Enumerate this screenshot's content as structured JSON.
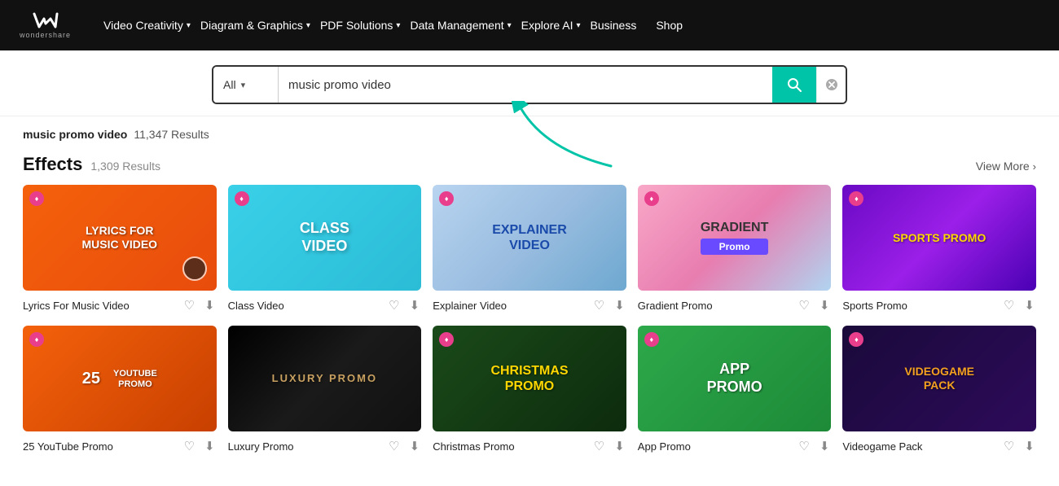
{
  "brand": {
    "name": "wondershare",
    "logo_symbol": "W"
  },
  "navbar": {
    "items": [
      {
        "label": "Video Creativity",
        "hasDropdown": true
      },
      {
        "label": "Diagram & Graphics",
        "hasDropdown": true
      },
      {
        "label": "PDF Solutions",
        "hasDropdown": true
      },
      {
        "label": "Data Management",
        "hasDropdown": true
      },
      {
        "label": "Explore AI",
        "hasDropdown": true
      },
      {
        "label": "Business",
        "hasDropdown": false
      },
      {
        "label": "Shop",
        "hasDropdown": false
      }
    ]
  },
  "search": {
    "dropdown_label": "All",
    "placeholder": "music promo video",
    "value": "music promo video",
    "search_button_label": "Search",
    "clear_button_label": "Clear"
  },
  "results": {
    "query": "music promo video",
    "count": "11,347 Results"
  },
  "effects_section": {
    "title": "Effects",
    "count": "1,309 Results",
    "view_more": "View More"
  },
  "cards_row1": [
    {
      "id": "lyrics-music-video",
      "title": "Lyrics For Music Video",
      "thumb_type": "lyrics",
      "thumb_label": "LYRICS FOR\nMUSIC VIDEO"
    },
    {
      "id": "class-video",
      "title": "Class Video",
      "thumb_type": "class",
      "thumb_label": "CLASS\nVIDEO"
    },
    {
      "id": "explainer-video",
      "title": "Explainer Video",
      "thumb_type": "explainer",
      "thumb_label": "EXPLAINER\nVIDEO"
    },
    {
      "id": "gradient-promo",
      "title": "Gradient Promo",
      "thumb_type": "gradient",
      "thumb_label": "GRADIENT\nPromo"
    },
    {
      "id": "sports-promo",
      "title": "Sports Promo",
      "thumb_type": "sports",
      "thumb_label": "SPORTS PROMO"
    }
  ],
  "cards_row2": [
    {
      "id": "youtube-promo",
      "title": "25 YouTube Promo",
      "thumb_type": "youtube",
      "thumb_label": "25\nYOUTUBE\nPROMO"
    },
    {
      "id": "luxury-promo",
      "title": "Luxury Promo",
      "thumb_type": "luxury",
      "thumb_label": "LUXURY PROMO"
    },
    {
      "id": "christmas-promo",
      "title": "Christmas Promo",
      "thumb_type": "christmas",
      "thumb_label": "CHRISTMAS\nPROMO"
    },
    {
      "id": "app-promo",
      "title": "App Promo",
      "thumb_type": "app",
      "thumb_label": "APP\nPROMO"
    },
    {
      "id": "videogame-pack",
      "title": "Videogame Pack",
      "thumb_type": "videogame",
      "thumb_label": "VIDEOGAME\nPACK"
    }
  ]
}
